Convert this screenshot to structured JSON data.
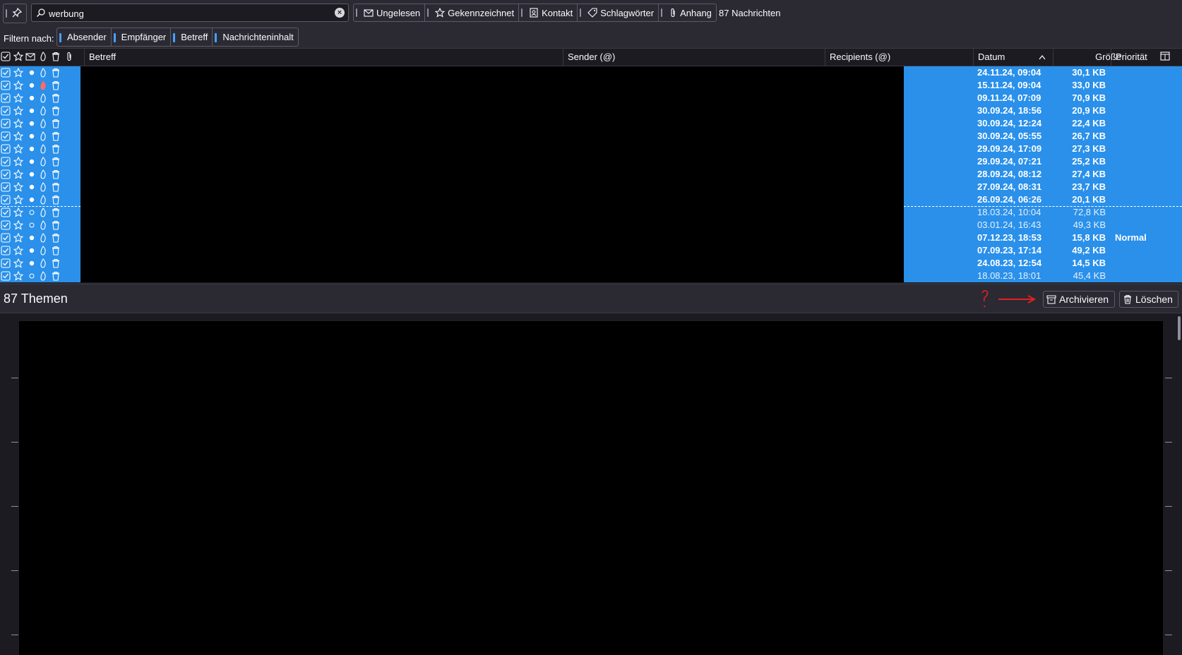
{
  "toolbar": {
    "search_value": "werbung",
    "quick_filters": [
      {
        "label": "Ungelesen",
        "icon": "envelope-icon"
      },
      {
        "label": "Gekennzeichnet",
        "icon": "star-icon"
      },
      {
        "label": "Kontakt",
        "icon": "contact-card-icon"
      },
      {
        "label": "Schlagwörter",
        "icon": "tag-icon"
      },
      {
        "label": "Anhang",
        "icon": "paperclip-icon"
      }
    ],
    "message_count": "87 Nachrichten"
  },
  "filter_bar": {
    "label": "Filtern nach:",
    "options": [
      "Absender",
      "Empfänger",
      "Betreff",
      "Nachrichteninhalt"
    ]
  },
  "columns": {
    "subject": "Betreff",
    "sender": "Sender (@)",
    "recipients": "Recipients (@)",
    "date": "Datum",
    "size": "Größe",
    "priority": "Priorität"
  },
  "messages": [
    {
      "date": "24.11.24, 09:04",
      "size": "30,1 KB",
      "priority": "",
      "unread": true,
      "junk": false
    },
    {
      "date": "15.11.24, 09:04",
      "size": "33,0 KB",
      "priority": "",
      "unread": true,
      "junk": true
    },
    {
      "date": "09.11.24, 07:09",
      "size": "70,9 KB",
      "priority": "",
      "unread": true,
      "junk": false
    },
    {
      "date": "30.09.24, 18:56",
      "size": "20,9 KB",
      "priority": "",
      "unread": true,
      "junk": false
    },
    {
      "date": "30.09.24, 12:24",
      "size": "22,4 KB",
      "priority": "",
      "unread": true,
      "junk": false
    },
    {
      "date": "30.09.24, 05:55",
      "size": "26,7 KB",
      "priority": "",
      "unread": true,
      "junk": false
    },
    {
      "date": "29.09.24, 17:09",
      "size": "27,3 KB",
      "priority": "",
      "unread": true,
      "junk": false
    },
    {
      "date": "29.09.24, 07:21",
      "size": "25,2 KB",
      "priority": "",
      "unread": true,
      "junk": false
    },
    {
      "date": "28.09.24, 08:12",
      "size": "27,4 KB",
      "priority": "",
      "unread": true,
      "junk": false
    },
    {
      "date": "27.09.24, 08:31",
      "size": "23,7 KB",
      "priority": "",
      "unread": true,
      "junk": false
    },
    {
      "date": "26.09.24, 06:26",
      "size": "20,1 KB",
      "priority": "",
      "unread": true,
      "junk": false
    },
    {
      "date": "18.03.24, 10:04",
      "size": "72,8 KB",
      "priority": "",
      "unread": false,
      "junk": false,
      "current": true
    },
    {
      "date": "03.01.24, 16:43",
      "size": "49,3 KB",
      "priority": "",
      "unread": false,
      "junk": false
    },
    {
      "date": "07.12.23, 18:53",
      "size": "15,8 KB",
      "priority": "Normal",
      "unread": true,
      "junk": false
    },
    {
      "date": "07.09.23, 17:14",
      "size": "49,2 KB",
      "priority": "",
      "unread": true,
      "junk": false
    },
    {
      "date": "24.08.23, 12:54",
      "size": "14,5 KB",
      "priority": "",
      "unread": true,
      "junk": false
    },
    {
      "date": "18.08.23, 18:01",
      "size": "45,4 KB",
      "priority": "",
      "unread": false,
      "junk": false
    }
  ],
  "thread_bar": {
    "count": "87 Themen",
    "archive_label": "Archivieren",
    "delete_label": "Löschen"
  },
  "colors": {
    "selection": "#2a90ea",
    "background": "#2b2a33",
    "annotation": "#e02020"
  }
}
